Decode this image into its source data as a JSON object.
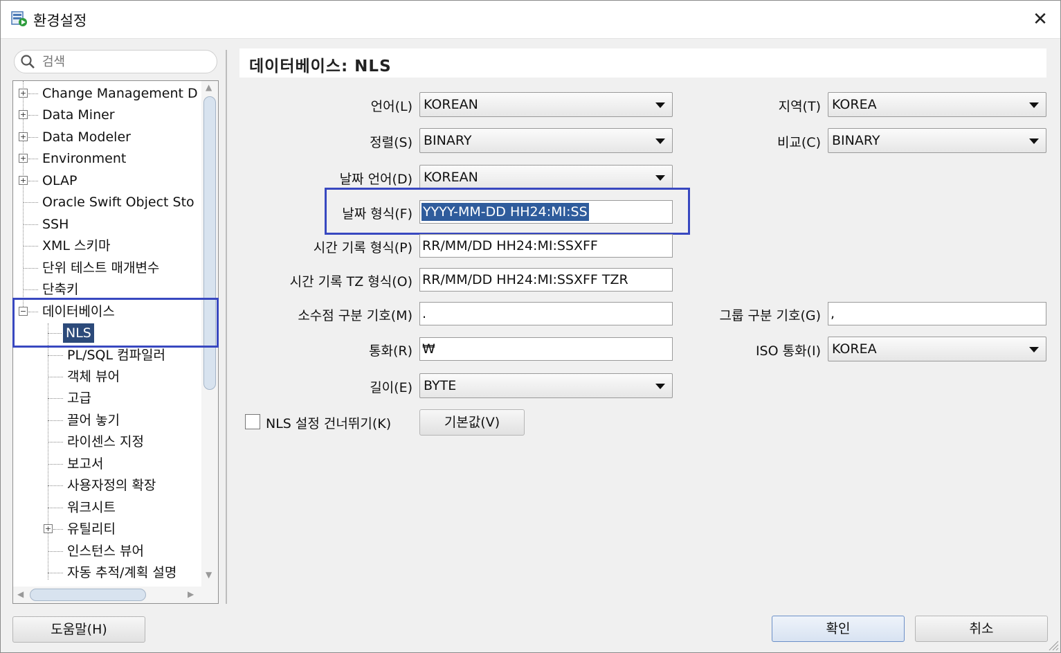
{
  "window": {
    "title": "환경설정",
    "close_glyph": "✕"
  },
  "search": {
    "placeholder": "검색"
  },
  "tree": {
    "items": [
      {
        "label": "Change Management D",
        "expander": "+"
      },
      {
        "label": "Data Miner",
        "expander": "+"
      },
      {
        "label": "Data Modeler",
        "expander": "+"
      },
      {
        "label": "Environment",
        "expander": "+"
      },
      {
        "label": "OLAP",
        "expander": "+"
      },
      {
        "label": "Oracle Swift Object Sto",
        "expander": ""
      },
      {
        "label": "SSH",
        "expander": ""
      },
      {
        "label": "XML 스키마",
        "expander": ""
      },
      {
        "label": "단위 테스트 매개변수",
        "expander": ""
      },
      {
        "label": "단축키",
        "expander": ""
      },
      {
        "label": "데이터베이스",
        "expander": "−"
      },
      {
        "label": "NLS",
        "expander": "",
        "selected": true
      },
      {
        "label": "PL/SQL 컴파일러",
        "expander": ""
      },
      {
        "label": "객체 뷰어",
        "expander": ""
      },
      {
        "label": "고급",
        "expander": ""
      },
      {
        "label": "끌어 놓기",
        "expander": ""
      },
      {
        "label": "라이센스 지정",
        "expander": ""
      },
      {
        "label": "보고서",
        "expander": ""
      },
      {
        "label": "사용자정의 확장",
        "expander": ""
      },
      {
        "label": "워크시트",
        "expander": ""
      },
      {
        "label": "유틸리티",
        "expander": "+"
      },
      {
        "label": "인스턴스 뷰어",
        "expander": ""
      },
      {
        "label": "자동 추적/계획 설명",
        "expander": ""
      }
    ]
  },
  "panel": {
    "title": "데이터베이스: NLS"
  },
  "form": {
    "language": {
      "label": "언어(L)",
      "value": "KOREAN"
    },
    "territory": {
      "label": "지역(T)",
      "value": "KOREA"
    },
    "sort": {
      "label": "정렬(S)",
      "value": "BINARY"
    },
    "comparison": {
      "label": "비교(C)",
      "value": "BINARY"
    },
    "date_language": {
      "label": "날짜 언어(D)",
      "value": "KOREAN"
    },
    "date_format": {
      "label": "날짜 형식(F)",
      "value": "YYYY-MM-DD HH24:MI:SS"
    },
    "timestamp_format": {
      "label": "시간 기록 형식(P)",
      "value": "RR/MM/DD HH24:MI:SSXFF"
    },
    "timestamp_tz_format": {
      "label": "시간 기록 TZ 형식(O)",
      "value": "RR/MM/DD HH24:MI:SSXFF TZR"
    },
    "decimal_separator": {
      "label": "소수점 구분 기호(M)",
      "value": "."
    },
    "group_separator": {
      "label": "그룹 구분 기호(G)",
      "value": ","
    },
    "currency": {
      "label": "통화(R)",
      "value": "₩"
    },
    "iso_currency": {
      "label": "ISO 통화(I)",
      "value": "KOREA"
    },
    "length": {
      "label": "길이(E)",
      "value": "BYTE"
    },
    "skip_nls": {
      "label": "NLS 설정 건너뛰기(K)",
      "checked": false
    },
    "default_button": "기본값(V)"
  },
  "buttons": {
    "help": "도움말(H)",
    "ok": "확인",
    "cancel": "취소"
  },
  "colors": {
    "selection": "#2c4a7a",
    "highlight_box": "#3848c0"
  }
}
